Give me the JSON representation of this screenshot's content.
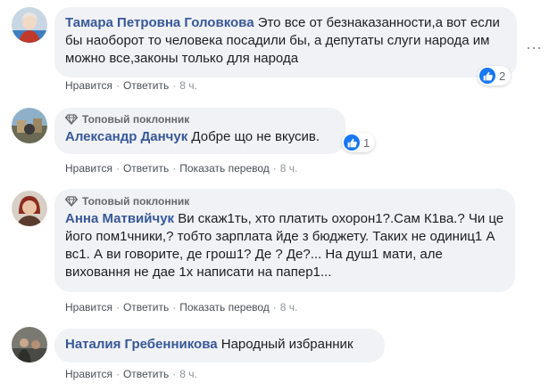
{
  "actions": {
    "like": "Нравится",
    "reply": "Ответить",
    "translate": "Показать перевод",
    "separator": "·"
  },
  "comments": [
    {
      "author": "Тамара Петровна Головкова",
      "text": "Это все от безнаказанности,а вот если бы наоборот то человека посадили бы, а депутаты слуги народа им можно все,законы только для народа",
      "time": "8 ч.",
      "reactions": "2"
    },
    {
      "badge": "Топовый поклонник",
      "author": "Александр Данчук",
      "text": "Добре що не вкусив.",
      "time": "8 ч.",
      "reactions": "1"
    },
    {
      "badge": "Топовый поклонник",
      "author": "Анна Матвийчук",
      "text": "Ви скаж1ть, хто платить охорон1?.Сам К1ва.? Чи це його пом1чники,? тобто зарплата йде з бюджету. Таких не одиниц1 А вс1. А ви говорите, де грош1? Де ? Де?... На душ1 мати, але виховання не дае 1х написати на папер1...",
      "time": "8 ч."
    },
    {
      "author": "Наталия Гребенникова",
      "text": "Народный избранник",
      "time": "8 ч."
    }
  ],
  "more_icon": "more-options-icon",
  "colors": {
    "author": "#385898",
    "bubble": "#f0f2f5",
    "like_blue": "#1877f2"
  }
}
